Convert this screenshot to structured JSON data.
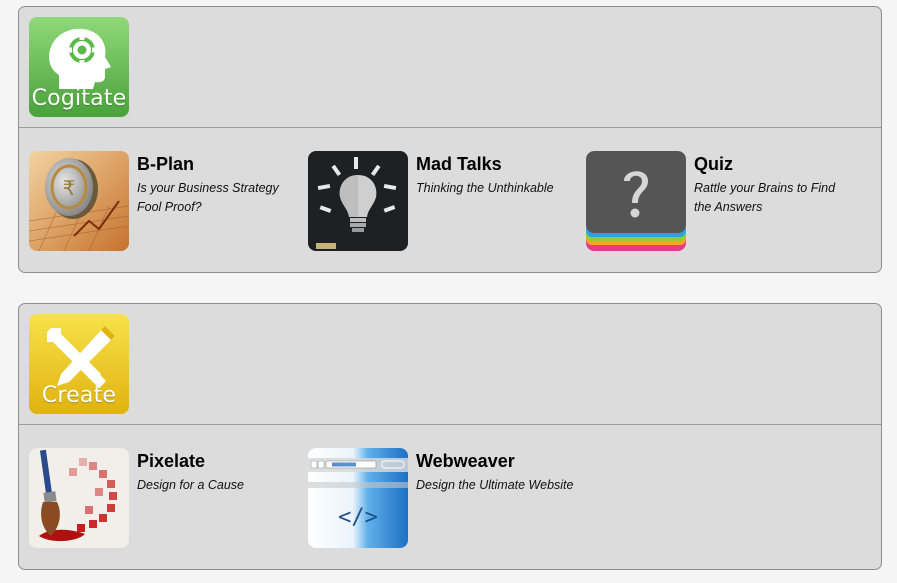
{
  "colors": {
    "cogitate_green": "#5cb84a",
    "create_yellow": "#e8c11a",
    "panel_bg": "#dcdcdc",
    "panel_border": "#8e8e8e"
  },
  "categories": [
    {
      "label": "Cogitate",
      "icon": "head-gear-icon",
      "items": [
        {
          "title": "B-Plan",
          "description": "Is your Business Strategy Fool Proof?",
          "icon": "coin-chart-icon"
        },
        {
          "title": "Mad Talks",
          "description": "Thinking the Unthinkable",
          "icon": "lightbulb-chalk-icon"
        },
        {
          "title": "Quiz",
          "description": "Rattle your Brains to Find the Answers",
          "icon": "question-mark-icon"
        }
      ]
    },
    {
      "label": "Create",
      "icon": "pencil-wrench-icon",
      "items": [
        {
          "title": "Pixelate",
          "description": "Design for a Cause",
          "icon": "paintbrush-pixels-icon"
        },
        {
          "title": "Webweaver",
          "description": "Design the Ultimate Website",
          "icon": "browser-code-icon"
        }
      ]
    }
  ]
}
